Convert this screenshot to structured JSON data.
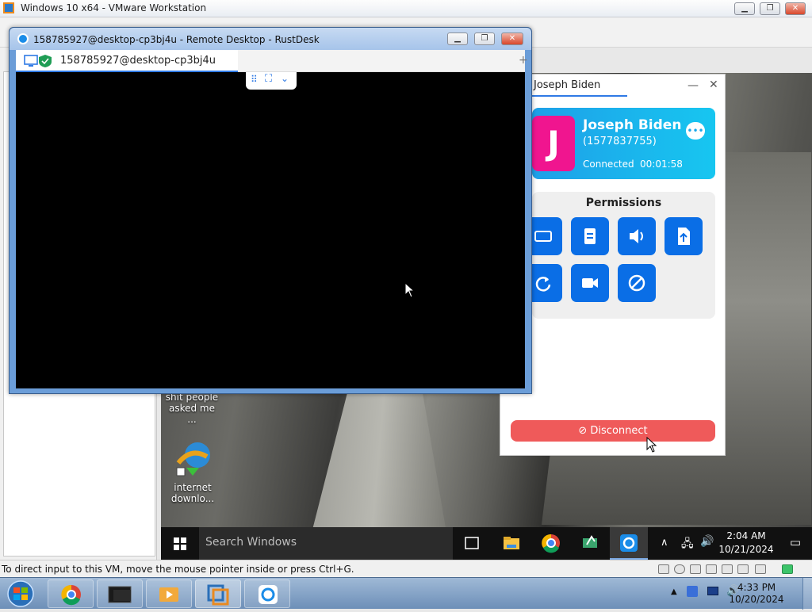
{
  "vmware": {
    "title": "Windows 10 x64 - VMware Workstation",
    "status_message": "To direct input to this VM, move the mouse pointer inside or press Ctrl+G."
  },
  "rustdesk_window": {
    "title": "158785927@desktop-cp3bj4u - Remote Desktop - RustDesk",
    "tab_label": "158785927@desktop-cp3bj4u",
    "add_tab": "+"
  },
  "guest_desktop": {
    "icons": [
      {
        "label_line1": "shit people",
        "label_line2": "asked me ..."
      },
      {
        "label_line1": "internet",
        "label_line2": "downlo..."
      }
    ],
    "taskbar": {
      "search_placeholder": "Search Windows",
      "time": "2:04 AM",
      "date": "10/21/2024"
    }
  },
  "connection_manager": {
    "tab_name": "Joseph Biden",
    "avatar_letter": "J",
    "peer_name": "Joseph Biden",
    "peer_id": "(1577837755)",
    "status": "Connected",
    "duration": "00:01:58",
    "permissions_title": "Permissions",
    "permissions": [
      "keyboard-icon",
      "clipboard-icon",
      "audio-icon",
      "file-transfer-icon",
      "restart-icon",
      "recording-icon",
      "block-input-icon"
    ],
    "disconnect_label": "Disconnect",
    "accent_color": "#0a6ee6",
    "disconnect_color": "#ef5a5a"
  },
  "host_taskbar": {
    "time": "4:33 PM",
    "date": "10/20/2024"
  }
}
